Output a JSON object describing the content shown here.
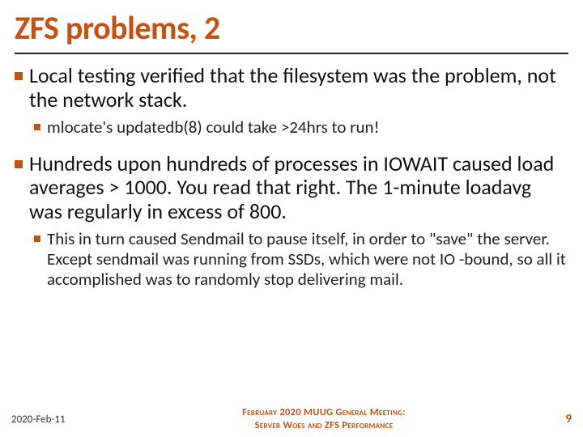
{
  "title": "ZFS problems, 2",
  "bullets": [
    {
      "level": 1,
      "text": "Local testing verified that the filesystem was the problem, not the network stack."
    },
    {
      "level": 2,
      "text": "mlocate's updatedb(8) could take >24hrs to run!"
    },
    {
      "level": 1,
      "text": "Hundreds upon hundreds of processes in IOWAIT caused load averages > 1000.  You read that right.  The 1-minute loadavg was regularly in excess of 800."
    },
    {
      "level": 2,
      "text": "This in turn caused Sendmail to pause itself, in order to \"save\" the server.  Except sendmail was running from SSDs, which were not IO -bound, so all it accomplished was to randomly stop delivering mail."
    }
  ],
  "footer": {
    "date": "2020-Feb-11",
    "center_line1": "February 2020 MUUG General Meeting:",
    "center_line2": "Server Woes and ZFS Performance",
    "page": "9"
  }
}
